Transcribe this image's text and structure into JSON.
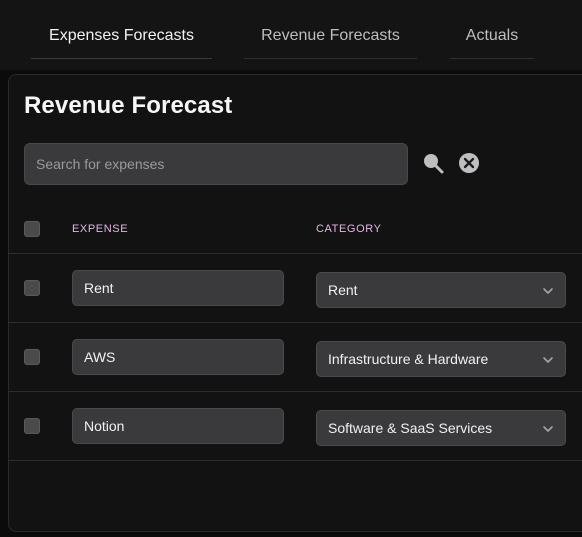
{
  "tabs": [
    {
      "label": "Expenses Forecasts",
      "active": true
    },
    {
      "label": "Revenue Forecasts",
      "active": false
    },
    {
      "label": "Actuals",
      "active": false
    }
  ],
  "card": {
    "title": "Revenue Forecast"
  },
  "search": {
    "placeholder": "Search for expenses",
    "value": ""
  },
  "table": {
    "columns": [
      "EXPENSE",
      "CATEGORY"
    ],
    "rows": [
      {
        "name": "Rent",
        "category": "Rent"
      },
      {
        "name": "AWS",
        "category": "Infrastructure & Hardware"
      },
      {
        "name": "Notion",
        "category": "Software & SaaS Services"
      }
    ]
  },
  "icons": {
    "search": "search-icon",
    "clear": "close-circle-icon",
    "checkbox": "checkbox-icon",
    "dropdown": "chevron-down-icon"
  },
  "colors": {
    "background": "#0b0b0c",
    "card": "#121213",
    "field": "#3a3a3c",
    "column_header": "#e6b5e8"
  }
}
